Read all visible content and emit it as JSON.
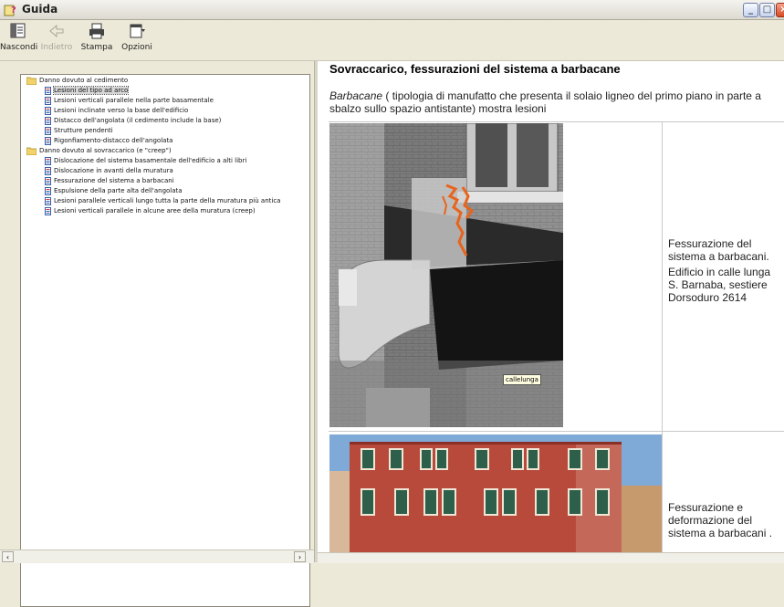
{
  "window": {
    "title": "Guida"
  },
  "window_controls": {
    "minimize": "_",
    "maximize": "□",
    "close": "×"
  },
  "toolbar": [
    {
      "label": "Nascondi",
      "icon": "hide-pane-icon",
      "enabled": true
    },
    {
      "label": "Indietro",
      "icon": "back-arrow-icon",
      "enabled": false
    },
    {
      "label": "Stampa",
      "icon": "printer-icon",
      "enabled": true
    },
    {
      "label": "Opzioni",
      "icon": "options-icon",
      "enabled": true
    }
  ],
  "tree": {
    "groups": [
      {
        "label": "Danno dovuto al cedimento",
        "items": [
          "Lesioni del tipo ad arco",
          "Lesioni verticali parallele nella parte basamentale",
          "Lesioni inclinate verso la base dell'edificio",
          "Distacco dell'angolata (il cedimento include la base)",
          "Strutture pendenti",
          "Rigonfiamento-distacco dell'angolata"
        ]
      },
      {
        "label": "Danno dovuto al sovraccarico (e \"creep\")",
        "items": [
          "Dislocazione del sistema basamentale dell'edificio a alti libri",
          "Dislocazione in avanti della muratura",
          "Fessurazione del sistema a barbacani",
          "Espulsione della parte alta dell'angolata",
          "Lesioni parallele verticali lungo tutta la parte della muratura più antica",
          "Lesioni verticali parallele in alcune aree della muratura (creep)"
        ]
      }
    ],
    "selected": "Lesioni del tipo ad arco"
  },
  "content": {
    "heading": "Sovraccarico, fessurazioni del sistema a barbacane",
    "desc_term": "Barbacane",
    "desc_rest": " ( tipologia di manufatto che presenta il solaio ligneo del primo piano in parte a sbalzo sullo spazio antistante) mostra lesioni",
    "photo_tag": "callelunga",
    "caption1_a": "Fessurazione del sistema a barbacani.",
    "caption1_b": "Edificio in calle lunga S. Barnaba, sestiere Dorsoduro 2614",
    "caption2": "Fessurazione e deformazione del sistema a barbacani ."
  },
  "colors": {
    "window_bg": "#ece9d8",
    "crack_highlight": "#e8641c",
    "facade": "#b84a3c",
    "sky": "#7fa9d6"
  }
}
